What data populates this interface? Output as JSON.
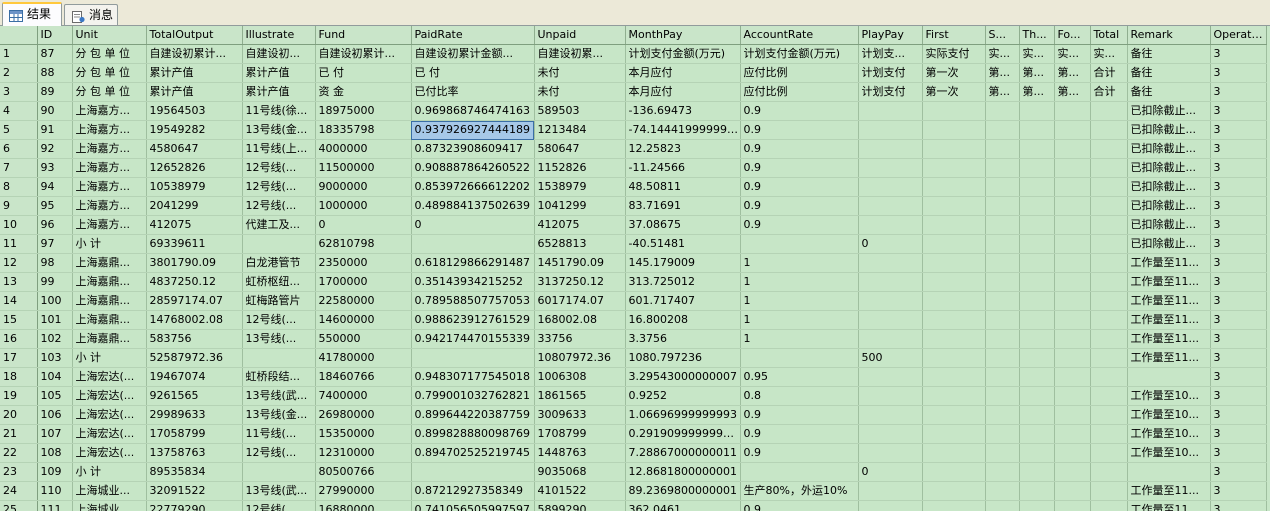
{
  "tabs": [
    {
      "label": "结果",
      "active": true,
      "icon": "grid-icon"
    },
    {
      "label": "消息",
      "active": false,
      "icon": "message-icon"
    }
  ],
  "grid": {
    "columns": [
      "",
      "ID",
      "Unit",
      "TotalOutput",
      "Illustrate",
      "Fund",
      "PaidRate",
      "Unpaid",
      "MonthPay",
      "AccountRate",
      "PlayPay",
      "First",
      "S...",
      "Th...",
      "Fo...",
      "Total",
      "Remark",
      "OperateID"
    ],
    "rows": [
      [
        "1",
        "87",
        "分 包 单 位",
        "自建设初累计...",
        "自建设初...",
        "自建设初累计...",
        "自建设初累计金额...",
        "自建设初累...",
        "计划支付金额(万元)",
        "计划支付金额(万元)",
        "计划支...",
        "实际支付",
        "实...",
        "实...",
        "实...",
        "实...",
        "备往",
        "3"
      ],
      [
        "2",
        "88",
        "分 包 单 位",
        "累计产值",
        "累计产值",
        "已 付",
        "已 付",
        "未付",
        "本月应付",
        "应付比例",
        "计划支付",
        "第一次",
        "第...",
        "第...",
        "第...",
        "合计",
        "备往",
        "3"
      ],
      [
        "3",
        "89",
        "分 包 单 位",
        "累计产值",
        "累计产值",
        "资 金",
        "已付比率",
        "未付",
        "本月应付",
        "应付比例",
        "计划支付",
        "第一次",
        "第...",
        "第...",
        "第...",
        "合计",
        "备往",
        "3"
      ],
      [
        "4",
        "90",
        "上海嘉方...",
        "19564503",
        "11号线(徐...",
        "18975000",
        "0.969868746474163",
        "589503",
        "-136.69473",
        "0.9",
        "",
        "",
        "",
        "",
        "",
        "",
        "已扣除截止...",
        "3"
      ],
      [
        "5",
        "91",
        "上海嘉方...",
        "19549282",
        "13号线(金...",
        "18335798",
        "0.937926927444189",
        "1213484",
        "-74.1444199999999",
        "0.9",
        "",
        "",
        "",
        "",
        "",
        "",
        "已扣除截止...",
        "3"
      ],
      [
        "6",
        "92",
        "上海嘉方...",
        "4580647",
        "11号线(上...",
        "4000000",
        "0.87323908609417",
        "580647",
        "12.25823",
        "0.9",
        "",
        "",
        "",
        "",
        "",
        "",
        "已扣除截止...",
        "3"
      ],
      [
        "7",
        "93",
        "上海嘉方...",
        "12652826",
        "12号线(...",
        "11500000",
        "0.908887864260522",
        "1152826",
        "-11.24566",
        "0.9",
        "",
        "",
        "",
        "",
        "",
        "",
        "已扣除截止...",
        "3"
      ],
      [
        "8",
        "94",
        "上海嘉方...",
        "10538979",
        "12号线(...",
        "9000000",
        "0.853972666612202",
        "1538979",
        "48.50811",
        "0.9",
        "",
        "",
        "",
        "",
        "",
        "",
        "已扣除截止...",
        "3"
      ],
      [
        "9",
        "95",
        "上海嘉方...",
        "2041299",
        "12号线(...",
        "1000000",
        "0.489884137502639",
        "1041299",
        "83.71691",
        "0.9",
        "",
        "",
        "",
        "",
        "",
        "",
        "已扣除截止...",
        "3"
      ],
      [
        "10",
        "96",
        "上海嘉方...",
        "412075",
        "代建工及...",
        "0",
        "0",
        "412075",
        "37.08675",
        "0.9",
        "",
        "",
        "",
        "",
        "",
        "",
        "已扣除截止...",
        "3"
      ],
      [
        "11",
        "97",
        "小 计",
        "69339611",
        "",
        "62810798",
        "",
        "6528813",
        "-40.51481",
        "",
        "0",
        "",
        "",
        "",
        "",
        "",
        "已扣除截止...",
        "3"
      ],
      [
        "12",
        "98",
        "上海嘉鼎...",
        "3801790.09",
        "白龙港管节",
        "2350000",
        "0.618129866291487",
        "1451790.09",
        "145.179009",
        "1",
        "",
        "",
        "",
        "",
        "",
        "",
        "工作量至11...",
        "3"
      ],
      [
        "13",
        "99",
        "上海嘉鼎...",
        "4837250.12",
        "虹桥枢纽...",
        "1700000",
        "0.35143934215252",
        "3137250.12",
        "313.725012",
        "1",
        "",
        "",
        "",
        "",
        "",
        "",
        "工作量至11...",
        "3"
      ],
      [
        "14",
        "100",
        "上海嘉鼎...",
        "28597174.07",
        "虹梅路管片",
        "22580000",
        "0.789588507757053",
        "6017174.07",
        "601.717407",
        "1",
        "",
        "",
        "",
        "",
        "",
        "",
        "工作量至11...",
        "3"
      ],
      [
        "15",
        "101",
        "上海嘉鼎...",
        "14768002.08",
        "12号线(...",
        "14600000",
        "0.988623912761529",
        "168002.08",
        "16.800208",
        "1",
        "",
        "",
        "",
        "",
        "",
        "",
        "工作量至11...",
        "3"
      ],
      [
        "16",
        "102",
        "上海嘉鼎...",
        "583756",
        "13号线(...",
        "550000",
        "0.942174470155339",
        "33756",
        "3.3756",
        "1",
        "",
        "",
        "",
        "",
        "",
        "",
        "工作量至11...",
        "3"
      ],
      [
        "17",
        "103",
        "小 计",
        "52587972.36",
        "",
        "41780000",
        "",
        "10807972.36",
        "1080.797236",
        "",
        "500",
        "",
        "",
        "",
        "",
        "",
        "工作量至11...",
        "3"
      ],
      [
        "18",
        "104",
        "上海宏达(...",
        "19467074",
        "虹桥段结...",
        "18460766",
        "0.948307177545018",
        "1006308",
        "3.29543000000007",
        "0.95",
        "",
        "",
        "",
        "",
        "",
        "",
        "",
        "3"
      ],
      [
        "19",
        "105",
        "上海宏达(...",
        "9261565",
        "13号线(武...",
        "7400000",
        "0.799001032762821",
        "1861565",
        "0.9252",
        "0.8",
        "",
        "",
        "",
        "",
        "",
        "",
        "工作量至10...",
        "3"
      ],
      [
        "20",
        "106",
        "上海宏达(...",
        "29989633",
        "13号线(金...",
        "26980000",
        "0.899644220387759",
        "3009633",
        "1.06696999999993",
        "0.9",
        "",
        "",
        "",
        "",
        "",
        "",
        "工作量至10...",
        "3"
      ],
      [
        "21",
        "107",
        "上海宏达(...",
        "17058799",
        "11号线(...",
        "15350000",
        "0.899828880098769",
        "1708799",
        "0.291909999999963",
        "0.9",
        "",
        "",
        "",
        "",
        "",
        "",
        "工作量至10...",
        "3"
      ],
      [
        "22",
        "108",
        "上海宏达(...",
        "13758763",
        "12号线(...",
        "12310000",
        "0.894702525219745",
        "1448763",
        "7.28867000000011",
        "0.9",
        "",
        "",
        "",
        "",
        "",
        "",
        "工作量至10...",
        "3"
      ],
      [
        "23",
        "109",
        "小 计",
        "89535834",
        "",
        "80500766",
        "",
        "9035068",
        "12.8681800000001",
        "",
        "0",
        "",
        "",
        "",
        "",
        "",
        "",
        "3"
      ],
      [
        "24",
        "110",
        "上海城业...",
        "32091522",
        "13号线(武...",
        "27990000",
        "0.87212927358349",
        "4101522",
        "89.2369800000001",
        "生产80%，外运10%",
        "",
        "",
        "",
        "",
        "",
        "",
        "工作量至11...",
        "3"
      ],
      [
        "25",
        "111",
        "上海城业...",
        "22779290",
        "12号线(...",
        "16880000",
        "0.741056505997597",
        "5899290",
        "362.0461",
        "0.9",
        "",
        "",
        "",
        "",
        "",
        "",
        "工作量至11...",
        "3"
      ]
    ]
  }
}
